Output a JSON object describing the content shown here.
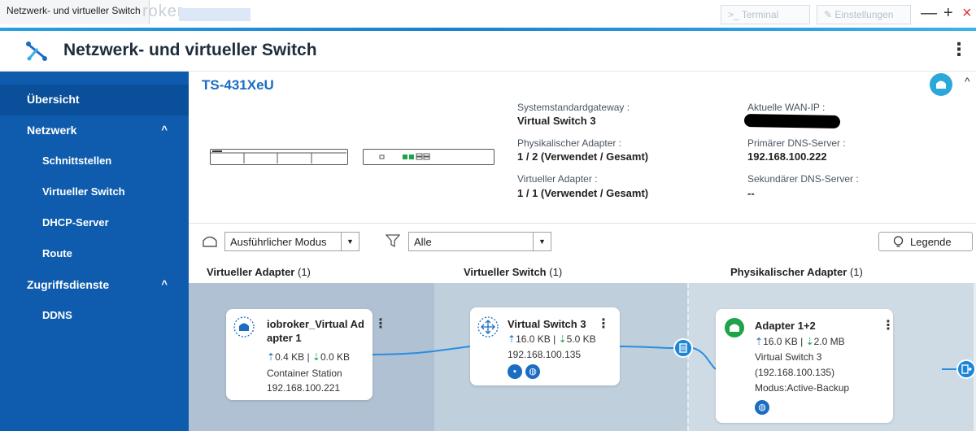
{
  "window": {
    "tab_title": "Netzwerk- und virtueller Switch",
    "ghost_title": "roker",
    "terminal_label": "Terminal",
    "settings_label": "Einstellungen",
    "minimize_label": "—",
    "maximize_label": "+",
    "close_label": "×"
  },
  "app": {
    "title": "Netzwerk- und virtueller Switch",
    "accent": "#0f5cae"
  },
  "sidebar": {
    "overview": "Übersicht",
    "network": {
      "label": "Netzwerk",
      "caret": "^"
    },
    "network_items": [
      "Schnittstellen",
      "Virtueller Switch",
      "DHCP-Server",
      "Route"
    ],
    "access": {
      "label": "Zugriffsdienste",
      "caret": "^"
    },
    "access_items": [
      "DDNS"
    ]
  },
  "device": {
    "name": "TS-431XeU",
    "gateway_label": "Systemstandardgateway :",
    "gateway_value": "Virtual Switch 3",
    "phys_label": "Physikalischer Adapter :",
    "phys_value": "1 / 2 (Verwendet / Gesamt)",
    "virt_label": "Virtueller Adapter :",
    "virt_value": "1 / 1 (Verwendet / Gesamt)",
    "wan_label": "Aktuelle WAN-IP :",
    "dns1_label": "Primärer DNS-Server :",
    "dns1_value": "192.168.100.222",
    "dns2_label": "Sekundärer DNS-Server :",
    "dns2_value": "--"
  },
  "toolbar": {
    "mode_value": "Ausführlicher Modus",
    "filter_value": "Alle",
    "legend_label": "Legende"
  },
  "columns": {
    "virtual_adapter": {
      "title": "Virtueller Adapter",
      "count": "(1)"
    },
    "virtual_switch": {
      "title": "Virtueller Switch",
      "count": "(1)"
    },
    "physical_adapter": {
      "title": "Physikalischer Adapter",
      "count": "(1)"
    }
  },
  "cards": {
    "adapter": {
      "name_line1": "iobroker_Virtual Ad",
      "name_line2": "apter 1",
      "up": "0.4 KB",
      "down": "0.0 KB",
      "sep": "|",
      "line3": "Container Station",
      "line4": "192.168.100.221"
    },
    "switch": {
      "name": "Virtual Switch 3",
      "up": "16.0 KB",
      "down": "5.0 KB",
      "sep": "|",
      "ip": "192.168.100.135"
    },
    "physical": {
      "name": "Adapter 1+2",
      "up": "16.0 KB",
      "down": "2.0 MB",
      "sep": "|",
      "line3": "Virtual Switch 3",
      "line4": "(192.168.100.135)",
      "line5": "Modus:Active-Backup"
    }
  }
}
